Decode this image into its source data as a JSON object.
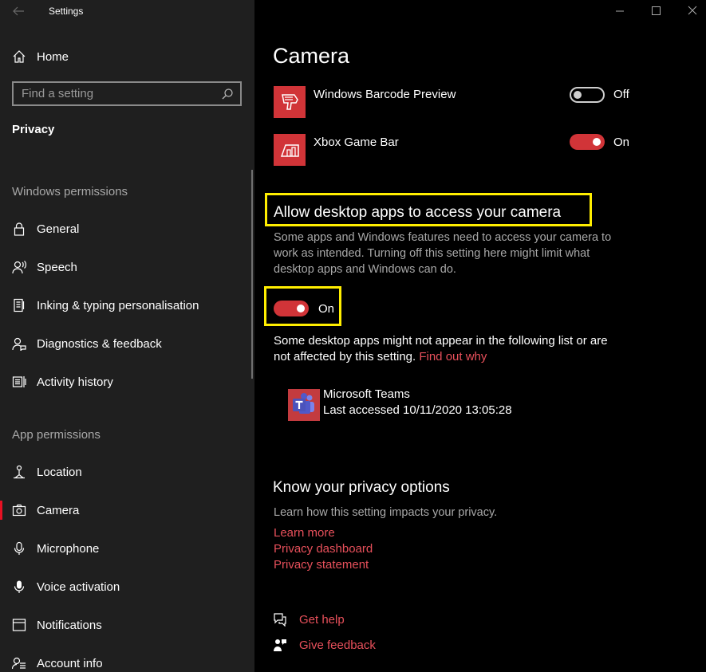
{
  "window": {
    "title": "Settings"
  },
  "sidebar": {
    "home_label": "Home",
    "search_placeholder": "Find a setting",
    "category_title": "Privacy",
    "windows_permissions_label": "Windows permissions",
    "app_permissions_label": "App permissions",
    "windows_items": [
      {
        "label": "General",
        "icon": "lock-icon"
      },
      {
        "label": "Speech",
        "icon": "speech-icon"
      },
      {
        "label": "Inking & typing personalisation",
        "icon": "inking-icon"
      },
      {
        "label": "Diagnostics & feedback",
        "icon": "diagnostics-icon"
      },
      {
        "label": "Activity history",
        "icon": "activity-history-icon"
      }
    ],
    "app_items": [
      {
        "label": "Location",
        "icon": "location-icon"
      },
      {
        "label": "Camera",
        "icon": "camera-icon",
        "selected": true
      },
      {
        "label": "Microphone",
        "icon": "microphone-icon"
      },
      {
        "label": "Voice activation",
        "icon": "voice-activation-icon"
      },
      {
        "label": "Notifications",
        "icon": "notifications-icon"
      },
      {
        "label": "Account info",
        "icon": "account-info-icon"
      }
    ]
  },
  "main": {
    "page_title": "Camera",
    "apps": [
      {
        "name": "Windows Barcode Preview",
        "state": "Off",
        "icon": "barcode-scanner-icon"
      },
      {
        "name": "Xbox Game Bar",
        "state": "On",
        "icon": "xbox-game-bar-icon"
      }
    ],
    "desktop_section": {
      "title": "Allow desktop apps to access your camera",
      "description_lines": [
        "Some apps and Windows features need to access your camera to",
        "work as intended. Turning off this setting here might limit what",
        "desktop apps and Windows can do."
      ],
      "toggle_state": "On",
      "note_line1": "Some desktop apps might not appear in the following list or are",
      "note_line2_prefix": "not affected by this setting. ",
      "note_link": "Find out why",
      "desktop_app": {
        "name": "Microsoft Teams",
        "last_accessed": "Last accessed 10/11/2020 13:05:28",
        "icon": "microsoft-teams-icon"
      }
    },
    "privacy_options": {
      "title": "Know your privacy options",
      "description": "Learn how this setting impacts your privacy.",
      "links": [
        "Learn more",
        "Privacy dashboard",
        "Privacy statement"
      ]
    },
    "help": {
      "get_help": "Get help",
      "give_feedback": "Give feedback"
    }
  },
  "colors": {
    "accent": "#d13438",
    "highlight": "#ffee00",
    "link": "#e8505b",
    "sidebar_bg": "#1f1f1f",
    "main_bg": "#000000"
  }
}
